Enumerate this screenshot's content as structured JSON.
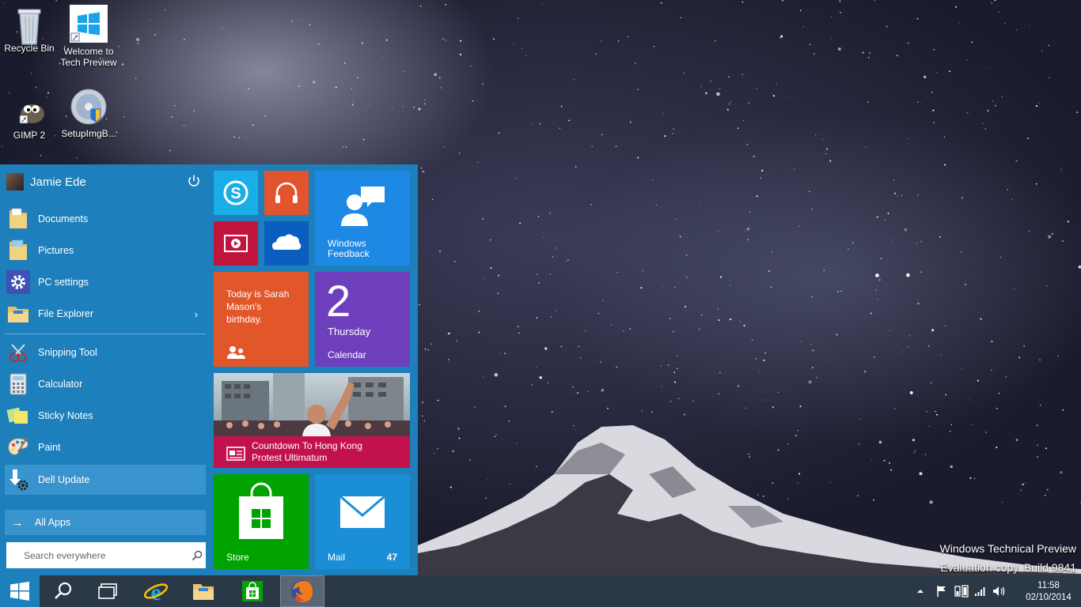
{
  "desktop": {
    "icons": [
      {
        "label": "Recycle Bin"
      },
      {
        "label_line1": "Welcome to",
        "label_line2": "Tech Preview"
      },
      {
        "label": "GIMP 2"
      },
      {
        "label": "SetupImgB..."
      }
    ],
    "watermark_line1": "Windows Technical Preview",
    "watermark_line2": "Evaluation copy. Build 9841"
  },
  "start_menu": {
    "user_name": "Jamie Ede",
    "places": [
      {
        "label": "Documents",
        "icon": "documents-folder-icon"
      },
      {
        "label": "Pictures",
        "icon": "pictures-folder-icon"
      },
      {
        "label": "PC settings",
        "icon": "gear-icon"
      },
      {
        "label": "File Explorer",
        "icon": "file-explorer-icon"
      }
    ],
    "apps": [
      {
        "label": "Snipping Tool",
        "icon": "snipping-tool-icon"
      },
      {
        "label": "Calculator",
        "icon": "calculator-icon"
      },
      {
        "label": "Sticky Notes",
        "icon": "sticky-notes-icon"
      },
      {
        "label": "Paint",
        "icon": "paint-palette-icon"
      },
      {
        "label": "Dell Update",
        "icon": "dell-update-icon"
      }
    ],
    "all_apps_label": "All Apps",
    "search_placeholder": "Search everywhere",
    "tiles": {
      "windows_feedback_line1": "Windows",
      "windows_feedback_line2": "Feedback",
      "people_line1": "Today is Sarah",
      "people_line2": "Mason's",
      "people_line3": "birthday.",
      "calendar_day_number": "2",
      "calendar_weekday": "Thursday",
      "calendar_label": "Calendar",
      "news_line1": "Countdown To Hong Kong",
      "news_line2": "Protest Ultimatum",
      "store_label": "Store",
      "mail_label": "Mail",
      "mail_count": "47"
    },
    "colors": {
      "menu_bg": "#1d7fbb",
      "skype": "#1aaee9",
      "music": "#e2542c",
      "video": "#c1153e",
      "onedrive": "#0a5ebf",
      "feedback": "#1e88e5",
      "people": "#e2572a",
      "calendar": "#6e3fbd",
      "news": "#c3124b",
      "store": "#00a300",
      "mail": "#1a8fd8"
    }
  },
  "taskbar": {
    "time": "11:58",
    "date": "02/10/2014"
  }
}
